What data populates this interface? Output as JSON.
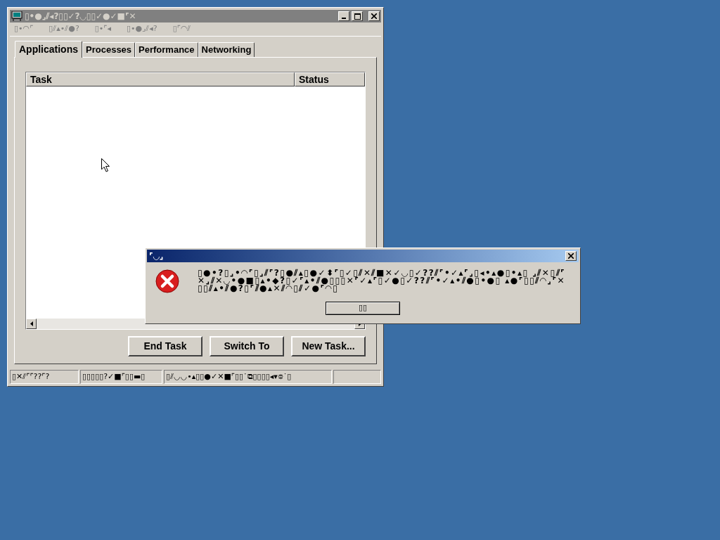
{
  "window": {
    "title": "▯•●⌟⫽◂?▯▯✓?◡▯▯✓●✓■⌜✕",
    "menu": [
      "▯•◠⌜",
      "▯⫽▴•⫽●?",
      "▯•⌜◂",
      "▯•●⌟⫽◂?",
      "▯⌜◠⫽"
    ],
    "tabs": [
      {
        "label": "Applications",
        "selected": true
      },
      {
        "label": "Processes",
        "selected": false
      },
      {
        "label": "Performance",
        "selected": false
      },
      {
        "label": "Networking",
        "selected": false
      }
    ],
    "table": {
      "columns": [
        "Task",
        "Status"
      ]
    },
    "buttons": [
      "End Task",
      "Switch To",
      "New Task..."
    ],
    "status_bar": [
      "▯✕⫽⌜⌜??⌜?",
      "▯▯▯▯▯?✓■⌜▯▯▬▯",
      "▯⫽◡◡•▴▯▯●✓✕■⌜▯▯˙⧉▯▯▯▯◂▾⯐˙▯"
    ]
  },
  "dialog": {
    "title": "⌜◡⌟",
    "message": "▯●•?▯⌟•◠⌜▯⌟⫽⌜?▯●⫽▴▯●✓⬍⌜▯✓▯⫽✕⫽■✕✓◡▯✓??⫽⌜•✓▴⌜⌟▯◂•▴●▯•▴▯ ⌟⫽✕▯⫽⌜✕⌟⫽✕◡•●■▯▴•◆?▯✓⌜▴•⫽●▯▯▯✕⌜✓▴⌜▯✓●▯✓??⫽⌜•✓▴•⫽●▯•●▯ ▴●⌜▯▯⫽◠⌟⌜✕▯▯⫽▴•⫽●?▯⌜⫽●▴✕⫽◠▯⫽✓●⌜◠▯",
    "button": "▯▯"
  }
}
